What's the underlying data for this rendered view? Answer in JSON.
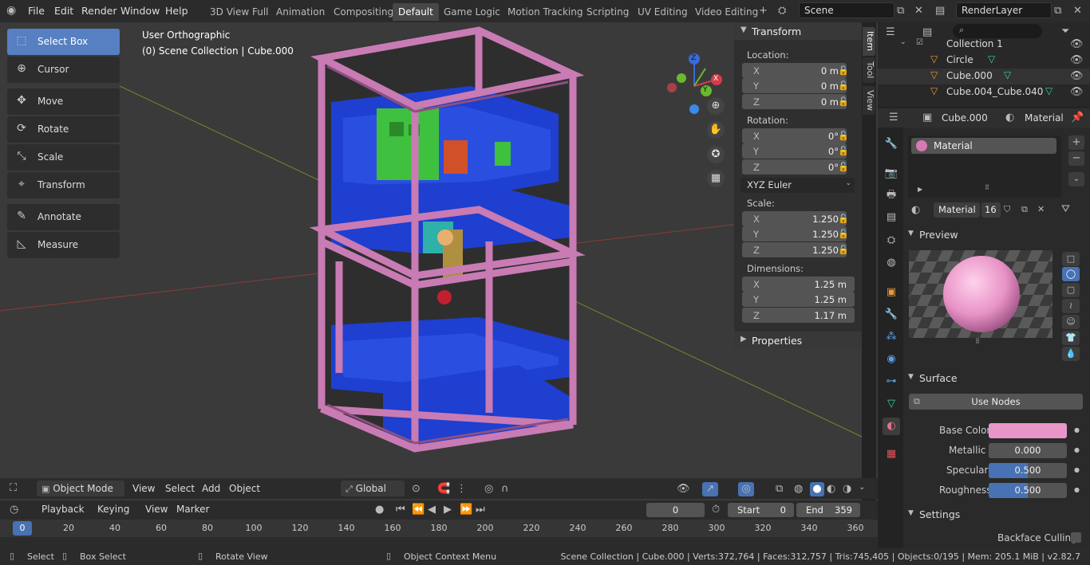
{
  "menu": [
    "File",
    "Edit",
    "Render",
    "Window",
    "Help"
  ],
  "workspaces": [
    "3D View Full",
    "Animation",
    "Compositing",
    "Default",
    "Game Logic",
    "Motion Tracking",
    "Scripting",
    "UV Editing",
    "Video Editing"
  ],
  "active_workspace": "Default",
  "scene": "Scene",
  "view_layer": "RenderLayer",
  "viewport": {
    "view_name": "User Orthographic",
    "collection_path": "(0) Scene Collection | Cube.000",
    "tools": [
      "Select Box",
      "Cursor",
      "Move",
      "Rotate",
      "Scale",
      "Transform",
      "Annotate",
      "Measure"
    ],
    "gizmo": {
      "z": "Z",
      "y": "Y",
      "x": "X"
    }
  },
  "npanel": {
    "tabs": [
      "Item",
      "Tool",
      "View"
    ],
    "transform_title": "Transform",
    "location_label": "Location:",
    "location": [
      {
        "axis": "X",
        "value": "0 m"
      },
      {
        "axis": "Y",
        "value": "0 m"
      },
      {
        "axis": "Z",
        "value": "0 m"
      }
    ],
    "rotation_label": "Rotation:",
    "rotation": [
      {
        "axis": "X",
        "value": "0°"
      },
      {
        "axis": "Y",
        "value": "0°"
      },
      {
        "axis": "Z",
        "value": "0°"
      }
    ],
    "rotation_mode": "XYZ Euler",
    "scale_label": "Scale:",
    "scale": [
      {
        "axis": "X",
        "value": "1.250"
      },
      {
        "axis": "Y",
        "value": "1.250"
      },
      {
        "axis": "Z",
        "value": "1.250"
      }
    ],
    "dimensions_label": "Dimensions:",
    "dimensions": [
      {
        "axis": "X",
        "value": "1.25 m"
      },
      {
        "axis": "Y",
        "value": "1.25 m"
      },
      {
        "axis": "Z",
        "value": "1.17 m"
      }
    ],
    "properties_title": "Properties"
  },
  "viewport_header": {
    "mode": "Object Mode",
    "menus": [
      "View",
      "Select",
      "Add",
      "Object"
    ],
    "orientation": "Global"
  },
  "timeline": {
    "menus": [
      "Playback",
      "Keying",
      "View",
      "Marker"
    ],
    "current_frame": "0",
    "start_label": "Start",
    "start": "0",
    "end_label": "End",
    "end": "359",
    "ruler": [
      "0",
      "20",
      "40",
      "60",
      "80",
      "100",
      "120",
      "140",
      "160",
      "180",
      "200",
      "220",
      "240",
      "260",
      "280",
      "300",
      "320",
      "340",
      "360"
    ]
  },
  "status": {
    "select": "Select",
    "box_select": "Box Select",
    "rotate_view": "Rotate View",
    "context_menu": "Object Context Menu",
    "stats": "Scene Collection | Cube.000 | Verts:372,764 | Faces:312,757 | Tris:745,405 | Objects:0/195 | Mem: 205.1 MiB | v2.82.7"
  },
  "outliner": {
    "items": [
      {
        "name": "Collection 1"
      },
      {
        "name": "Circle"
      },
      {
        "name": "Cube.000"
      },
      {
        "name": "Cube.004_Cube.040"
      }
    ]
  },
  "properties": {
    "object": "Cube.000",
    "context": "Material",
    "slot": "Material",
    "material_name": "Material",
    "users": "16",
    "preview_title": "Preview",
    "surface_title": "Surface",
    "use_nodes": "Use Nodes",
    "base_color_label": "Base Color",
    "base_color": "#e896c8",
    "metallic_label": "Metallic",
    "metallic": "0.000",
    "specular_label": "Specular",
    "specular": "0.500",
    "roughness_label": "Roughness",
    "roughness": "0.500",
    "settings_title": "Settings",
    "backface_label": "Backface Culling"
  },
  "colors": {
    "accent": "#5680c2",
    "frame_pink": "#c97bb4",
    "blue_part": "#1e3fd0",
    "green_part": "#3fc03f"
  }
}
